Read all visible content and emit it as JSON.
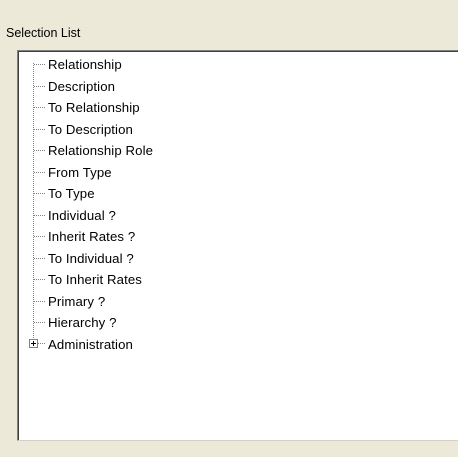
{
  "panel": {
    "title": "Selection List"
  },
  "tree": {
    "items": [
      {
        "label": "Relationship",
        "expandable": false
      },
      {
        "label": "Description",
        "expandable": false
      },
      {
        "label": "To Relationship",
        "expandable": false
      },
      {
        "label": "To Description",
        "expandable": false
      },
      {
        "label": "Relationship Role",
        "expandable": false
      },
      {
        "label": "From Type",
        "expandable": false
      },
      {
        "label": "To Type",
        "expandable": false
      },
      {
        "label": "Individual ?",
        "expandable": false
      },
      {
        "label": "Inherit Rates ?",
        "expandable": false
      },
      {
        "label": "To Individual ?",
        "expandable": false
      },
      {
        "label": "To Inherit Rates",
        "expandable": false
      },
      {
        "label": "Primary ?",
        "expandable": false
      },
      {
        "label": "Hierarchy ?",
        "expandable": false
      },
      {
        "label": "Administration",
        "expandable": true,
        "expanded": false
      }
    ]
  },
  "colors": {
    "window_bg": "#ece9d8",
    "tree_bg": "#ffffff",
    "tree_line": "#808080"
  }
}
